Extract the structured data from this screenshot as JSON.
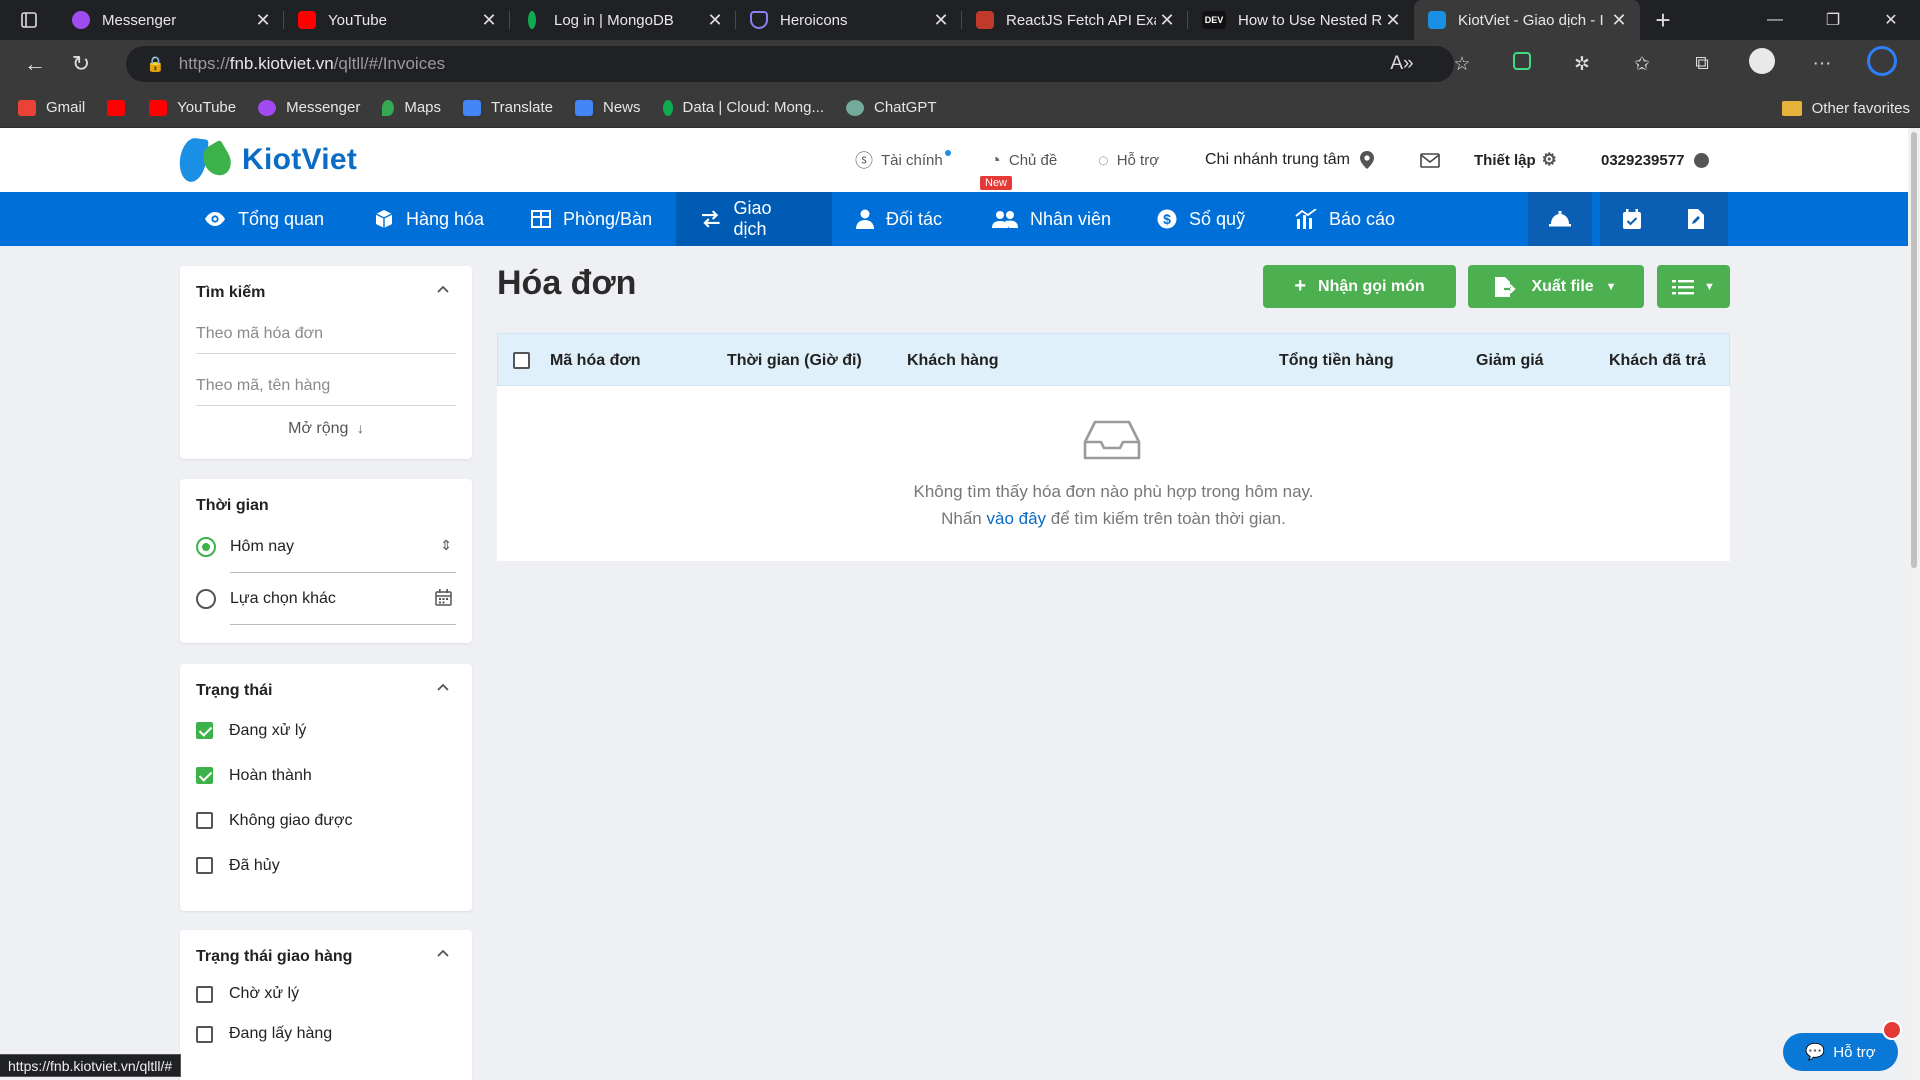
{
  "browser": {
    "tabs": [
      {
        "title": "Messenger",
        "favicon_color": "#a04bf0"
      },
      {
        "title": "YouTube",
        "favicon_color": "#ff0000"
      },
      {
        "title": "Log in | MongoDB",
        "favicon_color": "#10aa50"
      },
      {
        "title": "Heroicons",
        "favicon_color": "#6b5bd6"
      },
      {
        "title": "ReactJS Fetch API Exar",
        "favicon_color": "#c0392b"
      },
      {
        "title": "How to Use Nested Re",
        "favicon_color": "#111111"
      },
      {
        "title": "KiotViet - Giao dịch - I",
        "favicon_color": "#1a8fe3"
      }
    ],
    "url_prefix": "https://",
    "url_host": "fnb.kiotviet.vn",
    "url_path": "/qltll/#/Invoices",
    "bookmarks": [
      {
        "label": "Gmail",
        "color": "#ea4335"
      },
      {
        "label": "",
        "color": "#ff0000"
      },
      {
        "label": "YouTube",
        "color": "#ff0000"
      },
      {
        "label": "Messenger",
        "color": "#a04bf0"
      },
      {
        "label": "Maps",
        "color": "#34a853"
      },
      {
        "label": "Translate",
        "color": "#4285f4"
      },
      {
        "label": "News",
        "color": "#4285f4"
      },
      {
        "label": "Data | Cloud: Mong...",
        "color": "#10aa50"
      },
      {
        "label": "ChatGPT",
        "color": "#74aa9c"
      }
    ],
    "other_favorites": "Other favorites",
    "status_url": "https://fnb.kiotviet.vn/qltll/#"
  },
  "header": {
    "logo_text": "KiotViet",
    "finance": "Tài chính",
    "theme": "Chủ đề",
    "theme_badge": "New",
    "support": "Hỗ trợ",
    "branch": "Chi nhánh trung tâm",
    "settings": "Thiết lập",
    "phone": "0329239577"
  },
  "nav": {
    "items": [
      {
        "label": "Tổng quan",
        "icon": "eye-icon"
      },
      {
        "label": "Hàng hóa",
        "icon": "box-icon"
      },
      {
        "label": "Phòng/Bàn",
        "icon": "table-icon"
      },
      {
        "label": "Giao dịch",
        "icon": "transfer-icon"
      },
      {
        "label": "Đối tác",
        "icon": "partner-icon"
      },
      {
        "label": "Nhân viên",
        "icon": "users-icon"
      },
      {
        "label": "Sổ quỹ",
        "icon": "dollar-icon"
      },
      {
        "label": "Báo cáo",
        "icon": "chart-icon"
      }
    ],
    "active": "Giao dịch"
  },
  "sidebar": {
    "search": {
      "title": "Tìm kiếm",
      "invoice_placeholder": "Theo mã hóa đơn",
      "item_placeholder": "Theo mã, tên hàng",
      "expand": "Mở rộng"
    },
    "time": {
      "title": "Thời gian",
      "today": "Hôm nay",
      "other": "Lựa chọn khác"
    },
    "status": {
      "title": "Trạng thái",
      "options": [
        {
          "label": "Đang xử lý",
          "checked": true
        },
        {
          "label": "Hoàn thành",
          "checked": true
        },
        {
          "label": "Không giao được",
          "checked": false
        },
        {
          "label": "Đã hủy",
          "checked": false
        }
      ]
    },
    "delivery": {
      "title": "Trạng thái giao hàng",
      "options": [
        {
          "label": "Chờ xử lý",
          "checked": false
        },
        {
          "label": "Đang lấy hàng",
          "checked": false
        }
      ]
    }
  },
  "main": {
    "title": "Hóa đơn",
    "order_button": "Nhận gọi món",
    "export_button": "Xuất file",
    "columns": [
      "Mã hóa đơn",
      "Thời gian (Giờ đi)",
      "Khách hàng",
      "Tổng tiền hàng",
      "Giảm giá",
      "Khách đã trả"
    ],
    "empty_line1": "Không tìm thấy hóa đơn nào phù hợp trong hôm nay.",
    "empty_prefix": "Nhấn",
    "empty_link": "vào đây",
    "empty_suffix": "để tìm kiếm trên toàn thời gian."
  },
  "help_button": "Hỗ trợ"
}
